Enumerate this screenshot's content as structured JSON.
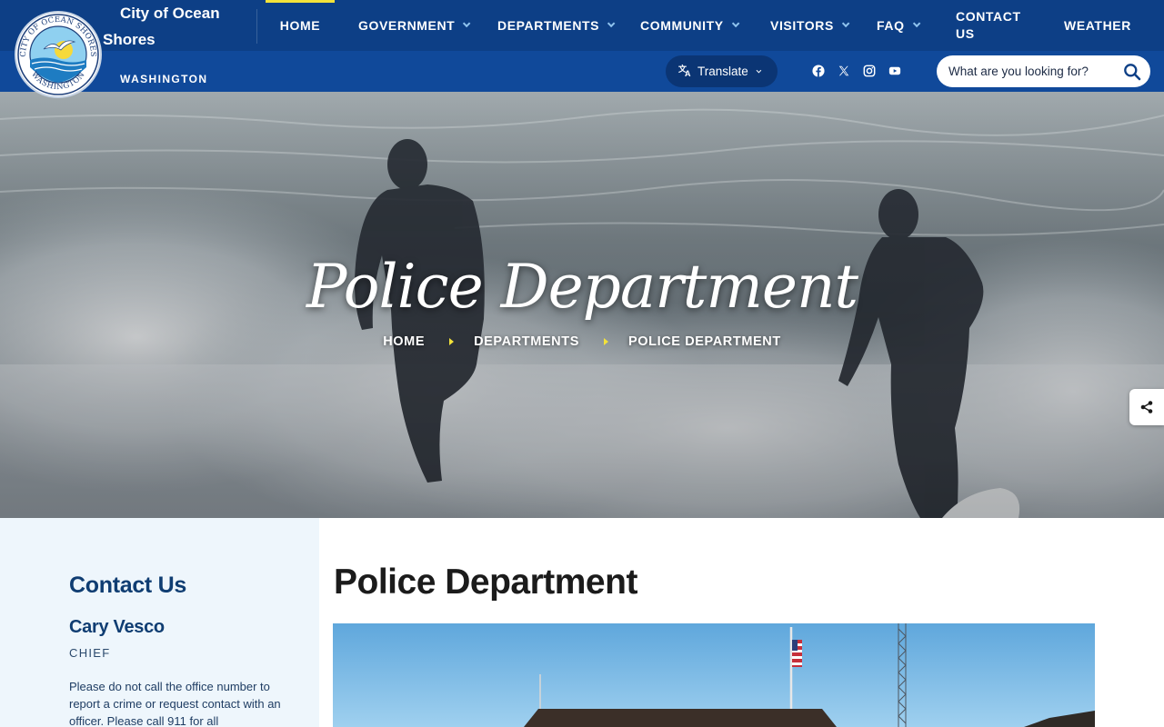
{
  "site": {
    "name_line1": "City of Ocean",
    "name_line2": "Shores",
    "state": "WASHINGTON",
    "logo_text": "CITY OF OCEAN SHORES · WASHINGTON"
  },
  "nav": {
    "items": [
      {
        "label": "HOME",
        "has_dropdown": false,
        "active": true
      },
      {
        "label": "GOVERNMENT",
        "has_dropdown": true
      },
      {
        "label": "DEPARTMENTS",
        "has_dropdown": true
      },
      {
        "label": "COMMUNITY",
        "has_dropdown": true
      },
      {
        "label": "VISITORS",
        "has_dropdown": true
      },
      {
        "label": "FAQ",
        "has_dropdown": true
      },
      {
        "label": "CONTACT US",
        "line1": "CONTACT",
        "line2": "US",
        "has_dropdown": false
      },
      {
        "label": "WEATHER",
        "has_dropdown": false
      }
    ]
  },
  "utility": {
    "translate_label": "Translate",
    "social": [
      "facebook-icon",
      "x-icon",
      "instagram-icon",
      "youtube-icon"
    ],
    "search_placeholder": "What are you looking for?"
  },
  "hero": {
    "title": "Police Department",
    "breadcrumb": [
      "HOME",
      "DEPARTMENTS",
      "POLICE DEPARTMENT"
    ]
  },
  "sidebar": {
    "heading": "Contact Us",
    "contact_name": "Cary Vesco",
    "contact_title": "CHIEF",
    "note": "Please do not call the office number to report a crime or request contact with an officer.   Please call 911 for all"
  },
  "main": {
    "page_title": "Police Department"
  },
  "colors": {
    "nav_bg": "#0d3f86",
    "subbar_bg": "#10499a",
    "accent_yellow": "#f3e23a",
    "heading_blue": "#0f3d72",
    "sidebar_bg": "#eef6fc"
  }
}
